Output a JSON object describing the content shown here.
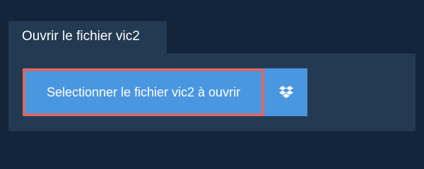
{
  "tab": {
    "label": "Ouvrir le fichier vic2"
  },
  "panel": {
    "select_button_label": "Selectionner le fichier vic2 à ouvrir",
    "dropbox_icon": "dropbox-icon"
  },
  "colors": {
    "background": "#13253b",
    "panel": "#233a52",
    "button": "#4a97e1",
    "highlight_border": "#d86a66",
    "text": "#ffffff"
  }
}
